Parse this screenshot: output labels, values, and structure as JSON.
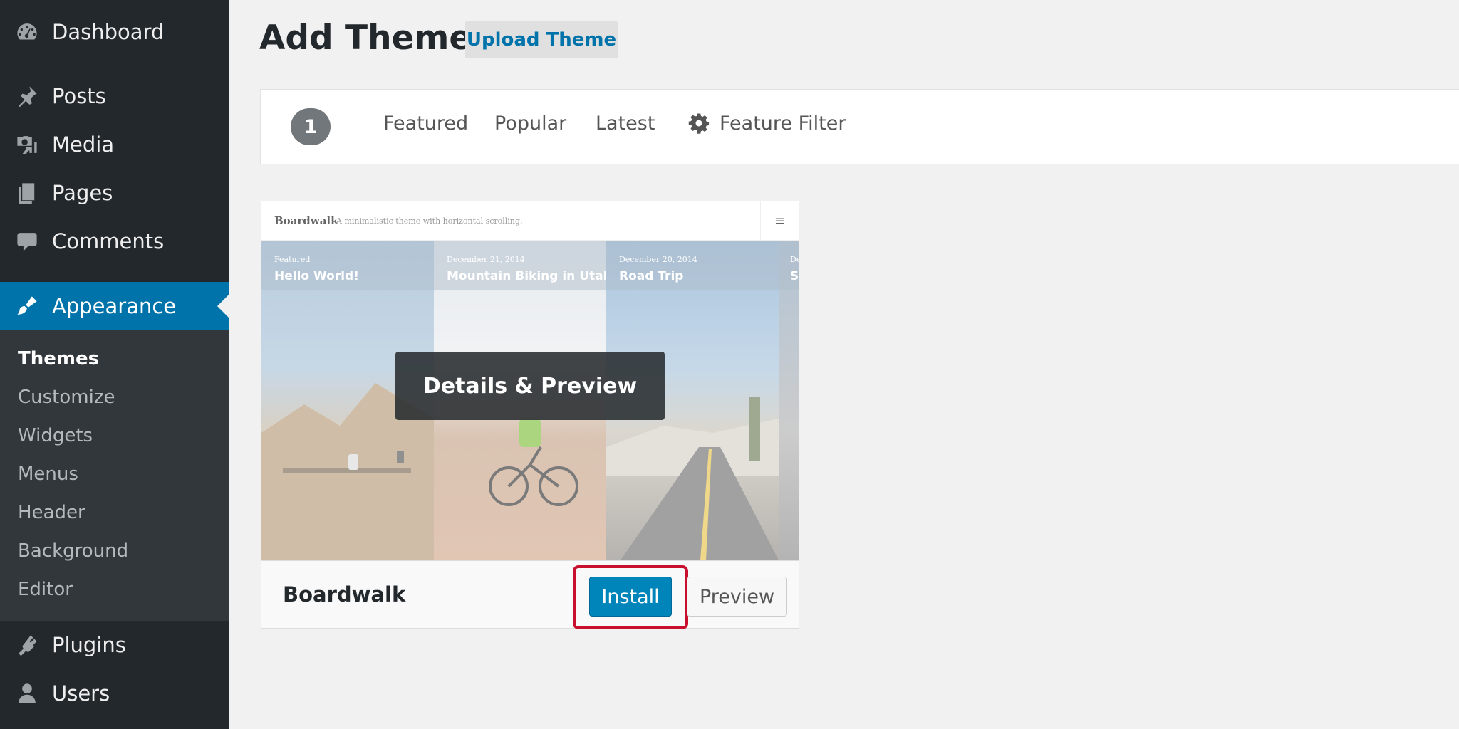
{
  "sidebar": {
    "items": [
      {
        "label": "Dashboard",
        "icon": "dashboard-icon"
      },
      {
        "label": "Posts",
        "icon": "pushpin-icon"
      },
      {
        "label": "Media",
        "icon": "media-icon"
      },
      {
        "label": "Pages",
        "icon": "pages-icon"
      },
      {
        "label": "Comments",
        "icon": "comment-icon"
      },
      {
        "label": "Appearance",
        "icon": "paintbrush-icon",
        "current": true
      },
      {
        "label": "Plugins",
        "icon": "plug-icon"
      },
      {
        "label": "Users",
        "icon": "user-icon"
      }
    ],
    "submenu": [
      {
        "label": "Themes",
        "active": true
      },
      {
        "label": "Customize"
      },
      {
        "label": "Widgets"
      },
      {
        "label": "Menus"
      },
      {
        "label": "Header"
      },
      {
        "label": "Background"
      },
      {
        "label": "Editor"
      }
    ],
    "colors": {
      "background": "#23282d",
      "submenu": "#32373c",
      "current": "#0073aa"
    }
  },
  "header": {
    "title": "Add Themes",
    "upload_button": "Upload Theme"
  },
  "filter_bar": {
    "count": "1",
    "links": [
      "Featured",
      "Popular",
      "Latest"
    ],
    "feature_filter": "Feature Filter",
    "feature_filter_icon": "gear-icon"
  },
  "theme": {
    "name": "Boardwalk",
    "install_label": "Install",
    "preview_label": "Preview",
    "details_overlay": "Details & Preview",
    "screenshot": {
      "brand": "Boardwalk",
      "tagline": "A minimalistic theme with horizontal scrolling.",
      "menu_icon": "hamburger-icon",
      "panels": [
        {
          "date": "Featured",
          "title": "Hello World!"
        },
        {
          "date": "December 21, 2014",
          "title": "Mountain Biking in Utah"
        },
        {
          "date": "December 20, 2014",
          "title": "Road Trip"
        },
        {
          "date": "De",
          "title": "St"
        }
      ]
    },
    "colors": {
      "install": "#0085ba",
      "highlight": "#c8102e"
    }
  }
}
